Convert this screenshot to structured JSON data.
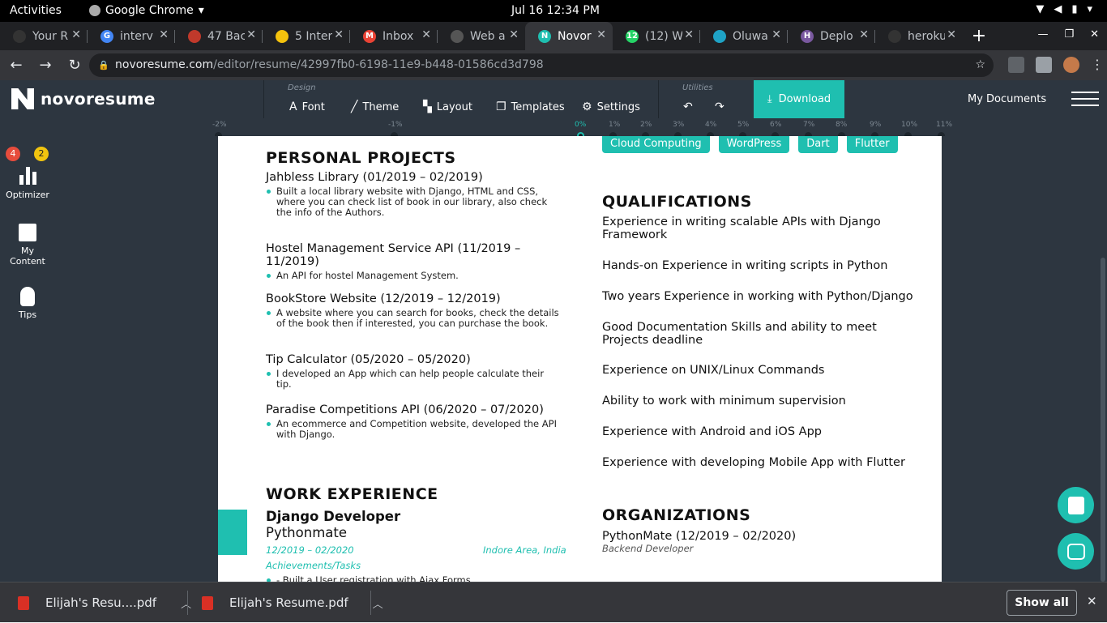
{
  "os": {
    "activities": "Activities",
    "app_name": "Google Chrome",
    "clock": "Jul 16  12:34 PM"
  },
  "tabs": [
    {
      "label": "Your R",
      "color": "#333"
    },
    {
      "label": "interv",
      "color": "#4285f4"
    },
    {
      "label": "47 Bac",
      "color": "#c0392b"
    },
    {
      "label": "5 Inter",
      "color": "#f4c20d"
    },
    {
      "label": "Inbox",
      "color": "#ea4335"
    },
    {
      "label": "Web a",
      "color": "#555"
    },
    {
      "label": "Novor",
      "color": "#1fbfb0"
    },
    {
      "label": "(12) W",
      "color": "#25d366"
    },
    {
      "label": "Oluwa",
      "color": "#1fa3c6"
    },
    {
      "label": "Deplo",
      "color": "#79589f"
    },
    {
      "label": "heroku",
      "color": "#333"
    }
  ],
  "address": {
    "host": "novoresume.com",
    "path": "/editor/resume/42997fb0-6198-11e9-b448-01586cd3d798"
  },
  "appbar": {
    "brand": "novoresume",
    "design_label": "Design",
    "font": "Font",
    "theme": "Theme",
    "layout": "Layout",
    "templates": "Templates",
    "settings": "Settings",
    "utilities_label": "Utilities",
    "download": "Download",
    "my_documents": "My Documents"
  },
  "ruler": {
    "ticks": [
      "-2%",
      "-1%",
      "0%",
      "1%",
      "2%",
      "3%",
      "4%",
      "5%",
      "6%",
      "7%",
      "8%",
      "9%",
      "10%",
      "11%"
    ]
  },
  "sidebar": {
    "optimizer": "Optimizer",
    "badge_red": "4",
    "badge_yellow": "2",
    "my_content_1": "My",
    "my_content_2": "Content",
    "tips": "Tips"
  },
  "resume": {
    "projects_heading": "PERSONAL PROJECTS",
    "projects": [
      {
        "title": "Jahbless Library (01/2019 – 02/2019)",
        "desc": "Built a local library website with Django, HTML and CSS, where you can check list of book in our library, also check the info of the Authors."
      },
      {
        "title": "Hostel Management Service API (11/2019 – 11/2019)",
        "desc": "An API for hostel Management System."
      },
      {
        "title": "BookStore Website (12/2019 – 12/2019)",
        "desc": "A website where you can search for books, check the details of the book then if interested, you can purchase the book."
      },
      {
        "title": "Tip Calculator (05/2020 – 05/2020)",
        "desc": "I developed an App which can help people calculate their tip."
      },
      {
        "title": "Paradise Competitions API (06/2020 – 07/2020)",
        "desc": "An ecommerce and Competition website, developed the API with Django."
      }
    ],
    "work_heading": "WORK EXPERIENCE",
    "job_title": "Django Developer",
    "company": "Pythonmate",
    "job_dates": "12/2019 – 02/2020",
    "job_location": "Indore Area, India",
    "achievements": "Achievements/Tasks",
    "first_task": "- Built a User registration with Ajax Forms",
    "skills": [
      "Cloud Computing",
      "WordPress",
      "Dart",
      "Flutter"
    ],
    "qual_heading": "QUALIFICATIONS",
    "qualifications": [
      "Experience in writing scalable APIs with Django Framework",
      "Hands-on Experience in writing scripts in Python",
      "Two years Experience in working with Python/Django",
      "Good Documentation Skills and ability to meet Projects deadline",
      "Experience on UNIX/Linux Commands",
      "Ability to work with minimum supervision",
      "Experience with Android and iOS App",
      "Experience with developing Mobile App with Flutter"
    ],
    "org_heading": "ORGANIZATIONS",
    "org_name": "PythonMate (12/2019 – 02/2020)",
    "org_role": "Backend Developer"
  },
  "downloads": {
    "item1": "Elijah's Resu....pdf",
    "item2": "Elijah's Resume.pdf",
    "show_all": "Show all"
  },
  "colors": {
    "accent": "#1fbfb0",
    "toolbar": "#2d3640"
  }
}
